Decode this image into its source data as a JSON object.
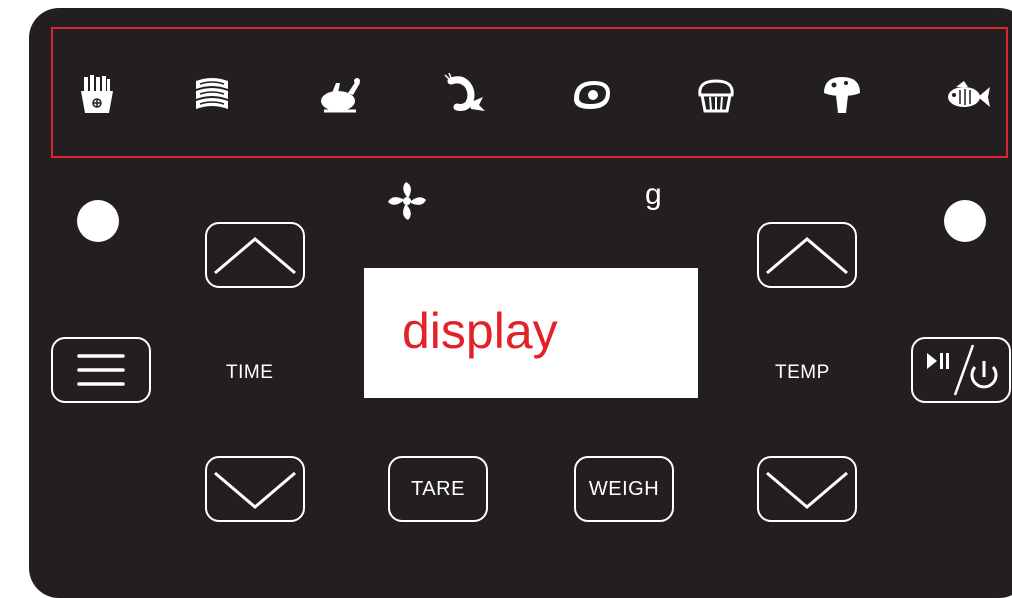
{
  "presets": [
    {
      "id": "fries",
      "icon": "fries-icon"
    },
    {
      "id": "bacon",
      "icon": "bacon-icon"
    },
    {
      "id": "chicken",
      "icon": "roast-chicken-icon"
    },
    {
      "id": "shrimp",
      "icon": "shrimp-icon"
    },
    {
      "id": "steak",
      "icon": "steak-icon"
    },
    {
      "id": "cake",
      "icon": "cupcake-icon"
    },
    {
      "id": "mushroom",
      "icon": "mushroom-icon"
    },
    {
      "id": "fish",
      "icon": "fish-icon"
    }
  ],
  "labels": {
    "time": "TIME",
    "temp": "TEMP",
    "unit": "g"
  },
  "display": {
    "text": "display",
    "color": "#e32129"
  },
  "buttons": {
    "tare": "TARE",
    "weigh": "WEIGH"
  },
  "colors": {
    "panel": "#231f20",
    "highlight_border": "#d7262e",
    "icon": "#ffffff"
  }
}
